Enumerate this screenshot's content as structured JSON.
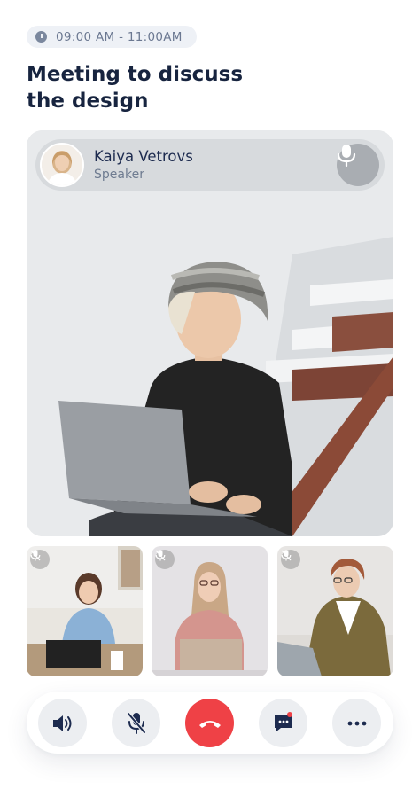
{
  "meeting": {
    "time_range": "09:00 AM - 11:00AM",
    "title_line1": "Meeting to discuss",
    "title_line2": "the design"
  },
  "speaker": {
    "name": "Kaiya Vetrovs",
    "role": "Speaker",
    "icon": "microphone-icon"
  },
  "participants": [
    {
      "icon": "mic-off-icon"
    },
    {
      "icon": "mic-off-icon"
    },
    {
      "icon": "mic-off-icon"
    }
  ],
  "controls": [
    {
      "name": "speaker",
      "icon": "speaker-icon"
    },
    {
      "name": "mute",
      "icon": "mic-off-icon"
    },
    {
      "name": "end-call",
      "icon": "phone-hangup-icon",
      "color": "#ef4146"
    },
    {
      "name": "chat",
      "icon": "chat-icon",
      "badge_color": "#ef4146"
    },
    {
      "name": "more",
      "icon": "more-icon"
    }
  ],
  "colors": {
    "accent_red": "#ef4146",
    "title_text": "#17243f",
    "muted_text": "#6b7891"
  }
}
